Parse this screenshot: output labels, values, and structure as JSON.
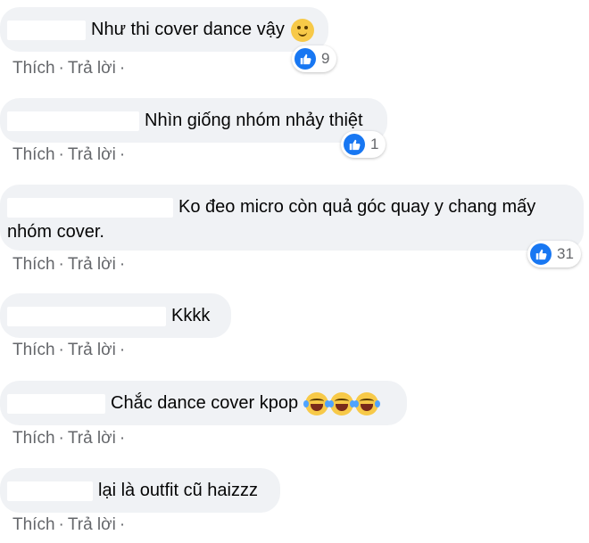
{
  "actions": {
    "like_label": "Thích",
    "reply_label": "Trả lời",
    "separator": "·"
  },
  "comments": [
    {
      "text": "Như thi cover dance vậy",
      "reaction_count": "9",
      "emoji": "smile-emoji"
    },
    {
      "text": "Nhìn giống nhóm nhảy thiệt",
      "reaction_count": "1"
    },
    {
      "text": "Ko đeo micro còn quả góc quay y chang mấy",
      "text2": "nhóm cover.",
      "reaction_count": "31"
    },
    {
      "text": "Kkkk"
    },
    {
      "text": "Chắc dance cover kpop",
      "emoji": "laugh-emoji"
    },
    {
      "text": "lại là outfit cũ haizzz"
    }
  ],
  "colors": {
    "bubble_bg": "#f0f2f5",
    "like_blue": "#1877f2",
    "meta_text": "#65676b"
  }
}
